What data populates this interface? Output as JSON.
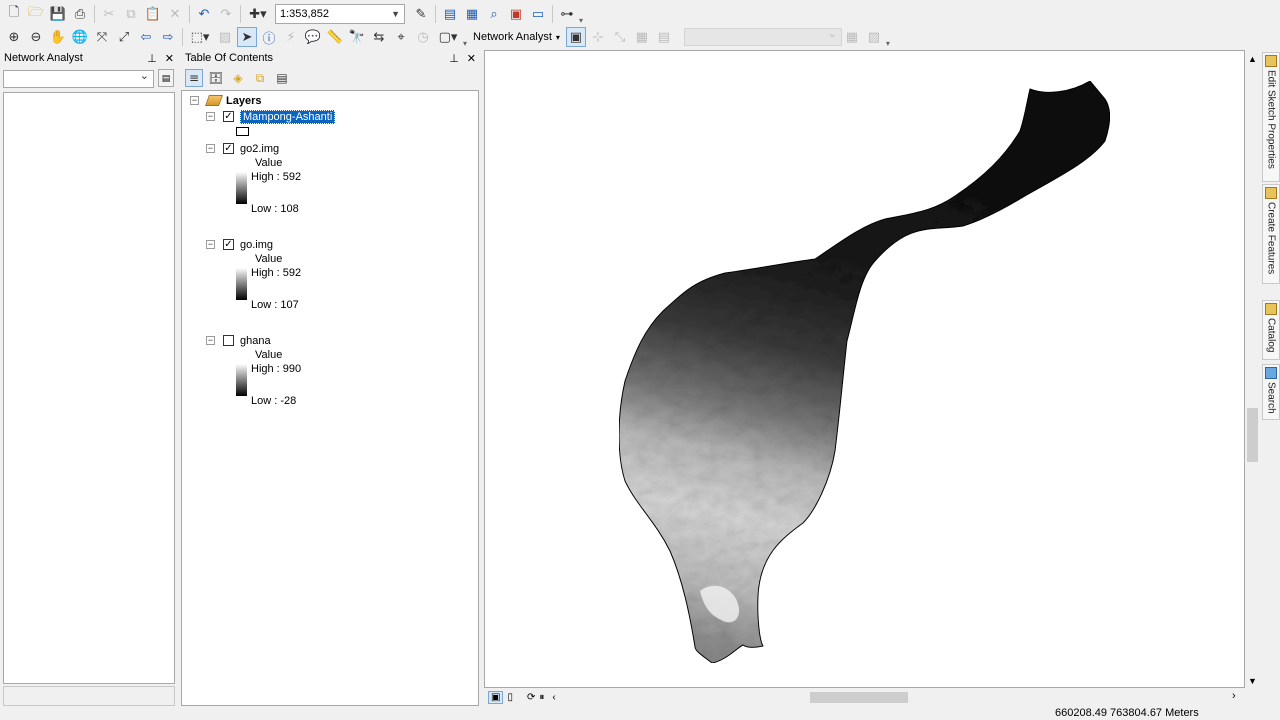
{
  "toolbar": {
    "scale_value": "1:353,852",
    "network_analyst_label": "Network Analyst"
  },
  "na_panel": {
    "title": "Network Analyst"
  },
  "toc": {
    "title": "Table Of Contents",
    "root": "Layers",
    "layers": [
      {
        "name": "Mampong-Ashanti",
        "checked": true,
        "selected": true
      },
      {
        "name": "go2.img",
        "checked": true,
        "field": "Value",
        "high": "High : 592",
        "low": "Low : 108"
      },
      {
        "name": "go.img",
        "checked": true,
        "field": "Value",
        "high": "High : 592",
        "low": "Low : 107"
      },
      {
        "name": "ghana",
        "checked": false,
        "field": "Value",
        "high": "High : 990",
        "low": "Low : -28"
      }
    ]
  },
  "dock": {
    "tabs": [
      "Edit Sketch Properties",
      "Create Features",
      "Catalog",
      "Search"
    ]
  },
  "status": {
    "coordinates": "660208.49  763804.67 Meters"
  },
  "colors": {
    "selection": "#0b64c0",
    "panel_bg": "#f0f0f0"
  }
}
